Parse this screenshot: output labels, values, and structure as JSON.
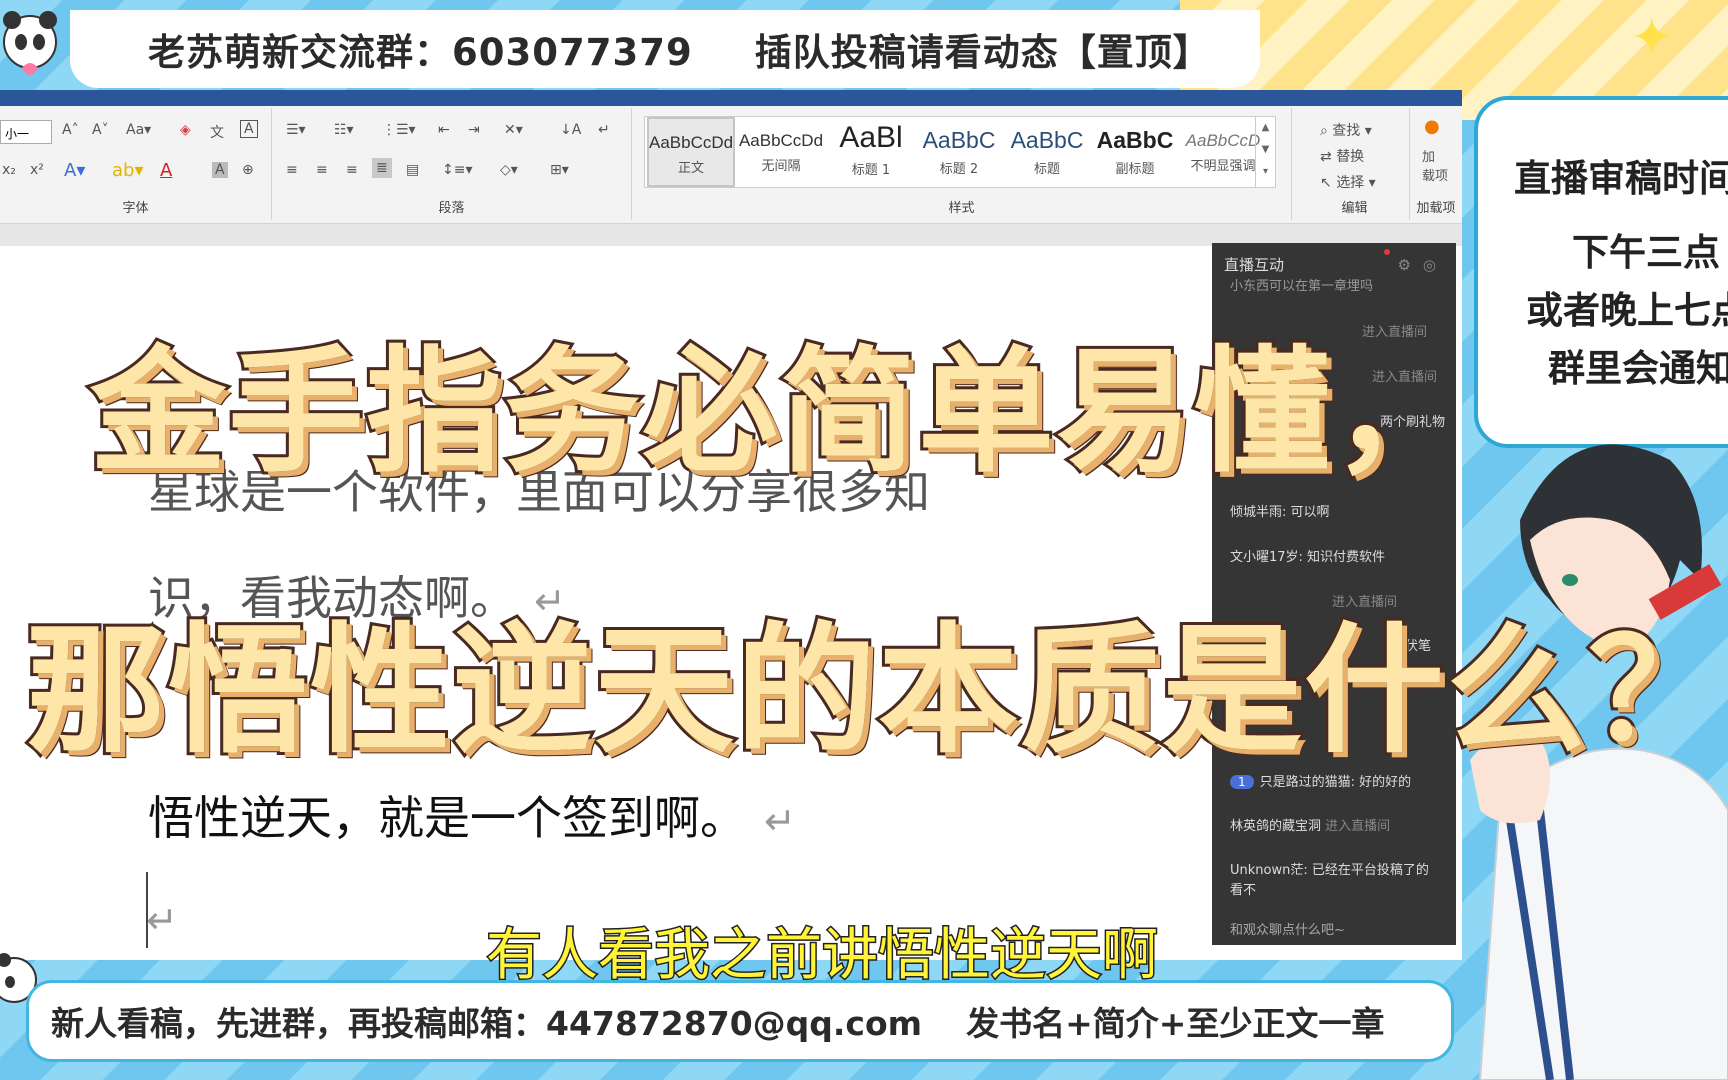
{
  "top_banner": {
    "group_text": "老苏萌新交流群：603077379",
    "notice_text": "插队投稿请看动态【置顶】"
  },
  "ribbon": {
    "font_size_value": "小一",
    "group_font": "字体",
    "group_paragraph": "段落",
    "group_styles": "样式",
    "group_edit": "编辑",
    "group_addin": "加载项",
    "find": "查找",
    "replace": "替换",
    "select": "选择",
    "addin_btn": "加\n载项",
    "styles": [
      {
        "sample": "AaBbCcDd",
        "name": "正文",
        "kind": "normal",
        "selected": true
      },
      {
        "sample": "AaBbCcDd",
        "name": "无间隔",
        "kind": "normal"
      },
      {
        "sample": "AaBl",
        "name": "标题 1",
        "kind": "big"
      },
      {
        "sample": "AaBbC",
        "name": "标题 2",
        "kind": "mid"
      },
      {
        "sample": "AaBbC",
        "name": "标题",
        "kind": "mid"
      },
      {
        "sample": "AaBbC",
        "name": "副标题",
        "kind": "mid"
      },
      {
        "sample": "AaBbCcD",
        "name": "不明显强调",
        "kind": "ital"
      }
    ]
  },
  "document": {
    "line1": "星球是一个软件，里面可以分享很多知",
    "line2": "识，看我动态啊。",
    "line3": "悟性逆天，就是一个签到啊。",
    "pilcrow": "↵"
  },
  "chat": {
    "title": "直播互动",
    "messages": [
      {
        "text": "小东西可以在第一章埋吗",
        "sys": ""
      },
      {
        "text": "",
        "sys": "进入直播间"
      },
      {
        "text": "",
        "sys": "进入直播间"
      },
      {
        "text": "两个刷礼物",
        "sys": ""
      },
      {
        "text": "倾城半雨: 可以啊",
        "sys": ""
      },
      {
        "text": "文小曜17岁: 知识付费软件",
        "sys": ""
      },
      {
        "text": "",
        "sys": "进入直播间"
      },
      {
        "text": "理伏笔",
        "sys": ""
      },
      {
        "text": "只是路过的猫猫: 好的好的",
        "sys": "",
        "badge": "1"
      },
      {
        "text": "林英鸽的藏宝洞",
        "sys": "进入直播间"
      },
      {
        "text": "Unknown茫: 已经在平台投稿了的",
        "sys": ""
      },
      {
        "text": "看不",
        "sys": ""
      }
    ],
    "input_placeholder": "和观众聊点什么吧~"
  },
  "right_card": {
    "line1": "直播审稿时间",
    "line2": "下午三点",
    "line3": "或者晚上七点",
    "line4": "群里会通知"
  },
  "overlay_title": {
    "line1": "金手指务必简单易懂，",
    "line2": "那悟性逆天的本质是什么？"
  },
  "subtitle": "有人看我之前讲悟性逆天啊",
  "bottom_banner": {
    "left_text": "新人看稿，先进群，再投稿邮箱：447872870@qq.com",
    "right_text": "发书名+简介+至少正文一章"
  },
  "colors": {
    "sky_blue": "#6fc6ee",
    "title_fill": "#fde6a7",
    "title_stroke": "#4a2a20",
    "subtitle_yellow": "#fff43a",
    "word_blue": "#2b579a"
  }
}
